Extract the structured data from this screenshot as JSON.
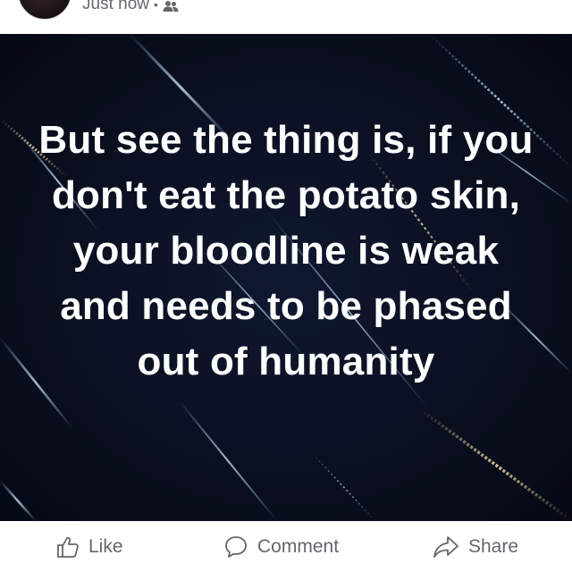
{
  "post": {
    "timestamp": "Just now",
    "separator": "•",
    "audience_icon": "friends-icon"
  },
  "image": {
    "quote": "But see the thing is, if you don't eat the potato skin, your bloodline is weak and needs to be phased out of humanity",
    "background_color": "#0a0f1f",
    "text_color": "#ffffff"
  },
  "actions": {
    "like": {
      "label": "Like",
      "icon": "thumbs-up-icon"
    },
    "comment": {
      "label": "Comment",
      "icon": "comment-bubble-icon"
    },
    "share": {
      "label": "Share",
      "icon": "share-arrow-icon"
    }
  },
  "colors": {
    "secondary_text": "#65676b"
  }
}
